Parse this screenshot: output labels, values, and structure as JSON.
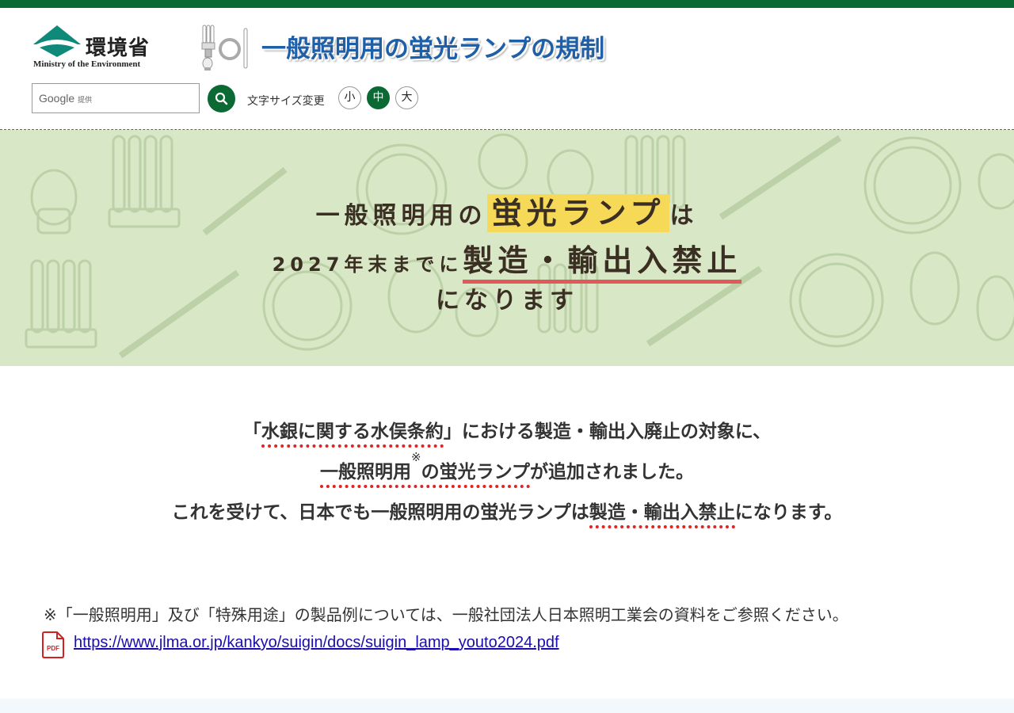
{
  "header": {
    "logo_jp": "環境省",
    "logo_en": "Ministry of the Environment",
    "site_title": "一般照明用の蛍光ランプの規制"
  },
  "search": {
    "brand": "Google",
    "brand_suffix": "提供",
    "placeholder": ""
  },
  "font_size": {
    "label": "文字サイズ変更",
    "small": "小",
    "medium": "中",
    "large": "大",
    "active": "中"
  },
  "hero": {
    "line1_pre": "一般照明用の",
    "line1_mark": "蛍光ランプ",
    "line1_post": "は",
    "line2_pre": "2027年末までに",
    "line2_mark": "製造・輸出入禁止",
    "line3": "になります"
  },
  "main": {
    "l1_open": "「",
    "l1_link": "水銀に関する水俣条約",
    "l1_rest": "」における製造・輸出入廃止の対象に、",
    "l2_link": "一般照明用",
    "l2_sup": "※",
    "l2_link2": "の蛍光ランプ",
    "l2_rest": "が追加されました。",
    "l3_pre": "これを受けて、日本でも一般照明用の蛍光ランプは",
    "l3_mark": "製造・輸出入禁止",
    "l3_post": "になります。"
  },
  "note": {
    "text": "※「一般照明用」及び「特殊用途」の製品例については、一般社団法人日本照明工業会の資料をご参照ください。",
    "pdf_label": "PDF",
    "link": "https://www.jlma.or.jp/kankyo/suigin/docs/suigin_lamp_youto2024.pdf"
  },
  "colors": {
    "brand_green": "#0b6a33",
    "title_blue": "#1f5fa8",
    "hero_bg": "#d8e8c6",
    "highlight_yellow": "#f6d957",
    "underline_red": "#e05a5a"
  }
}
